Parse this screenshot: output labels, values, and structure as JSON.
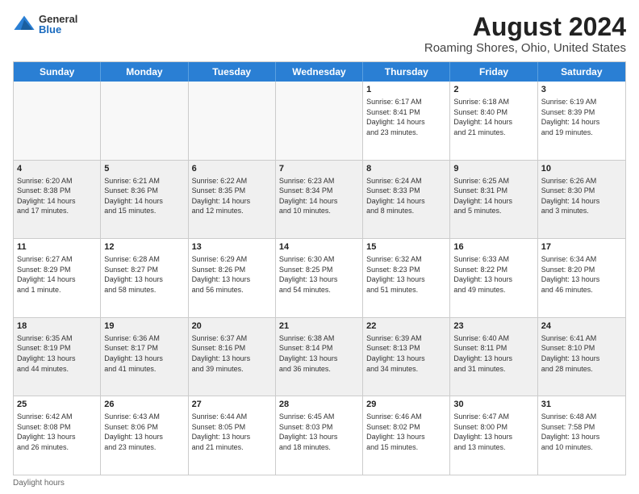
{
  "logo": {
    "general": "General",
    "blue": "Blue"
  },
  "title": "August 2024",
  "subtitle": "Roaming Shores, Ohio, United States",
  "days": [
    "Sunday",
    "Monday",
    "Tuesday",
    "Wednesday",
    "Thursday",
    "Friday",
    "Saturday"
  ],
  "footer": "Daylight hours",
  "weeks": [
    [
      {
        "num": "",
        "data": "",
        "empty": true
      },
      {
        "num": "",
        "data": "",
        "empty": true
      },
      {
        "num": "",
        "data": "",
        "empty": true
      },
      {
        "num": "",
        "data": "",
        "empty": true
      },
      {
        "num": "1",
        "data": "Sunrise: 6:17 AM\nSunset: 8:41 PM\nDaylight: 14 hours\nand 23 minutes.",
        "empty": false
      },
      {
        "num": "2",
        "data": "Sunrise: 6:18 AM\nSunset: 8:40 PM\nDaylight: 14 hours\nand 21 minutes.",
        "empty": false
      },
      {
        "num": "3",
        "data": "Sunrise: 6:19 AM\nSunset: 8:39 PM\nDaylight: 14 hours\nand 19 minutes.",
        "empty": false
      }
    ],
    [
      {
        "num": "4",
        "data": "Sunrise: 6:20 AM\nSunset: 8:38 PM\nDaylight: 14 hours\nand 17 minutes.",
        "empty": false
      },
      {
        "num": "5",
        "data": "Sunrise: 6:21 AM\nSunset: 8:36 PM\nDaylight: 14 hours\nand 15 minutes.",
        "empty": false
      },
      {
        "num": "6",
        "data": "Sunrise: 6:22 AM\nSunset: 8:35 PM\nDaylight: 14 hours\nand 12 minutes.",
        "empty": false
      },
      {
        "num": "7",
        "data": "Sunrise: 6:23 AM\nSunset: 8:34 PM\nDaylight: 14 hours\nand 10 minutes.",
        "empty": false
      },
      {
        "num": "8",
        "data": "Sunrise: 6:24 AM\nSunset: 8:33 PM\nDaylight: 14 hours\nand 8 minutes.",
        "empty": false
      },
      {
        "num": "9",
        "data": "Sunrise: 6:25 AM\nSunset: 8:31 PM\nDaylight: 14 hours\nand 5 minutes.",
        "empty": false
      },
      {
        "num": "10",
        "data": "Sunrise: 6:26 AM\nSunset: 8:30 PM\nDaylight: 14 hours\nand 3 minutes.",
        "empty": false
      }
    ],
    [
      {
        "num": "11",
        "data": "Sunrise: 6:27 AM\nSunset: 8:29 PM\nDaylight: 14 hours\nand 1 minute.",
        "empty": false
      },
      {
        "num": "12",
        "data": "Sunrise: 6:28 AM\nSunset: 8:27 PM\nDaylight: 13 hours\nand 58 minutes.",
        "empty": false
      },
      {
        "num": "13",
        "data": "Sunrise: 6:29 AM\nSunset: 8:26 PM\nDaylight: 13 hours\nand 56 minutes.",
        "empty": false
      },
      {
        "num": "14",
        "data": "Sunrise: 6:30 AM\nSunset: 8:25 PM\nDaylight: 13 hours\nand 54 minutes.",
        "empty": false
      },
      {
        "num": "15",
        "data": "Sunrise: 6:32 AM\nSunset: 8:23 PM\nDaylight: 13 hours\nand 51 minutes.",
        "empty": false
      },
      {
        "num": "16",
        "data": "Sunrise: 6:33 AM\nSunset: 8:22 PM\nDaylight: 13 hours\nand 49 minutes.",
        "empty": false
      },
      {
        "num": "17",
        "data": "Sunrise: 6:34 AM\nSunset: 8:20 PM\nDaylight: 13 hours\nand 46 minutes.",
        "empty": false
      }
    ],
    [
      {
        "num": "18",
        "data": "Sunrise: 6:35 AM\nSunset: 8:19 PM\nDaylight: 13 hours\nand 44 minutes.",
        "empty": false
      },
      {
        "num": "19",
        "data": "Sunrise: 6:36 AM\nSunset: 8:17 PM\nDaylight: 13 hours\nand 41 minutes.",
        "empty": false
      },
      {
        "num": "20",
        "data": "Sunrise: 6:37 AM\nSunset: 8:16 PM\nDaylight: 13 hours\nand 39 minutes.",
        "empty": false
      },
      {
        "num": "21",
        "data": "Sunrise: 6:38 AM\nSunset: 8:14 PM\nDaylight: 13 hours\nand 36 minutes.",
        "empty": false
      },
      {
        "num": "22",
        "data": "Sunrise: 6:39 AM\nSunset: 8:13 PM\nDaylight: 13 hours\nand 34 minutes.",
        "empty": false
      },
      {
        "num": "23",
        "data": "Sunrise: 6:40 AM\nSunset: 8:11 PM\nDaylight: 13 hours\nand 31 minutes.",
        "empty": false
      },
      {
        "num": "24",
        "data": "Sunrise: 6:41 AM\nSunset: 8:10 PM\nDaylight: 13 hours\nand 28 minutes.",
        "empty": false
      }
    ],
    [
      {
        "num": "25",
        "data": "Sunrise: 6:42 AM\nSunset: 8:08 PM\nDaylight: 13 hours\nand 26 minutes.",
        "empty": false
      },
      {
        "num": "26",
        "data": "Sunrise: 6:43 AM\nSunset: 8:06 PM\nDaylight: 13 hours\nand 23 minutes.",
        "empty": false
      },
      {
        "num": "27",
        "data": "Sunrise: 6:44 AM\nSunset: 8:05 PM\nDaylight: 13 hours\nand 21 minutes.",
        "empty": false
      },
      {
        "num": "28",
        "data": "Sunrise: 6:45 AM\nSunset: 8:03 PM\nDaylight: 13 hours\nand 18 minutes.",
        "empty": false
      },
      {
        "num": "29",
        "data": "Sunrise: 6:46 AM\nSunset: 8:02 PM\nDaylight: 13 hours\nand 15 minutes.",
        "empty": false
      },
      {
        "num": "30",
        "data": "Sunrise: 6:47 AM\nSunset: 8:00 PM\nDaylight: 13 hours\nand 13 minutes.",
        "empty": false
      },
      {
        "num": "31",
        "data": "Sunrise: 6:48 AM\nSunset: 7:58 PM\nDaylight: 13 hours\nand 10 minutes.",
        "empty": false
      }
    ]
  ]
}
